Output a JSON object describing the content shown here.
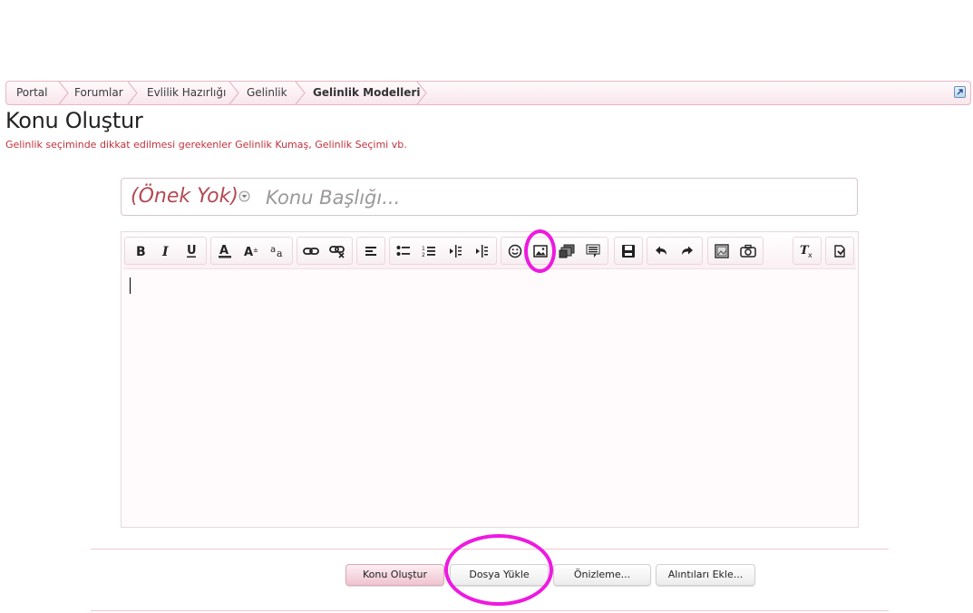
{
  "breadcrumb": {
    "items": [
      "Portal",
      "Forumlar",
      "Evlilik Hazırlığı",
      "Gelinlik",
      "Gelinlik Modelleri"
    ]
  },
  "page": {
    "title": "Konu Oluştur",
    "description": "Gelinlik seçiminde dikkat edilmesi gerekenler Gelinlik Kumaş, Gelinlik Seçimi vb."
  },
  "thread": {
    "prefix": "(Önek Yok)",
    "title_placeholder": "Konu Başlığı..."
  },
  "toolbar": {
    "icons": [
      "bold-icon",
      "italic-icon",
      "underline-icon",
      "font-color-icon",
      "font-size-icon",
      "font-family-icon",
      "link-icon",
      "unlink-icon",
      "align-icon",
      "bullet-list-icon",
      "numbered-list-icon",
      "outdent-icon",
      "indent-icon",
      "smiley-icon",
      "image-icon",
      "media-icon",
      "quote-icon",
      "save-draft-icon",
      "undo-icon",
      "redo-icon",
      "gallery-icon",
      "camera-icon",
      "remove-format-icon",
      "toggle-source-icon"
    ]
  },
  "buttons": {
    "submit": "Konu Oluştur",
    "upload": "Dosya Yükle",
    "preview": "Önizleme...",
    "quotes": "Alıntıları Ekle..."
  },
  "colors": {
    "accent": "#c0313b",
    "highlight": "#ee19e0",
    "border": "#e7b7c2"
  }
}
